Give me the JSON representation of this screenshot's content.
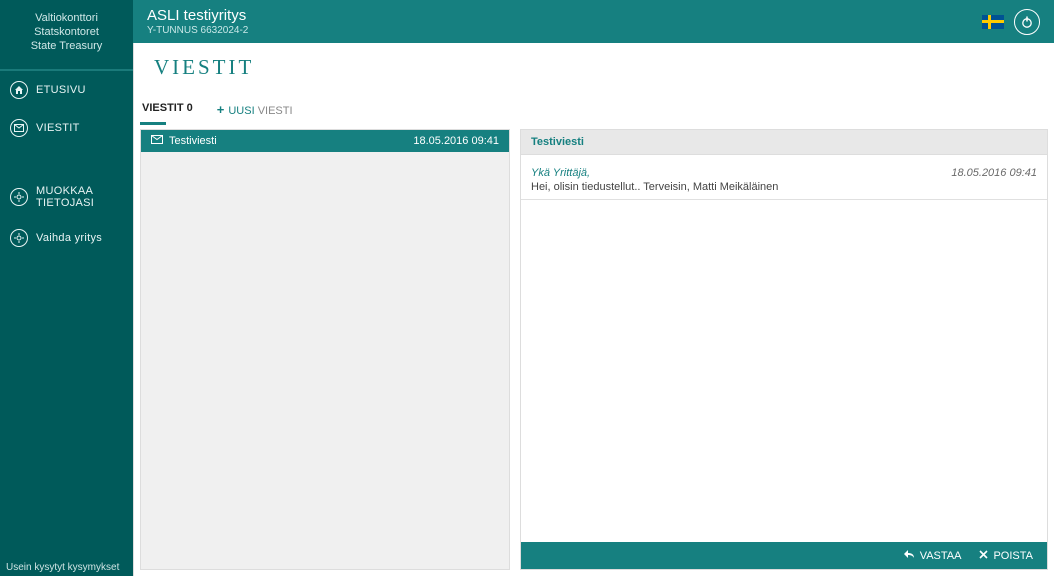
{
  "sidebar": {
    "logo_line1": "Valtiokonttori",
    "logo_line2": "Statskontoret",
    "logo_line3": "State Treasury",
    "nav": {
      "home": "ETUSIVU",
      "messages": "VIESTIT",
      "edit_info": "MUOKKAA TIETOJASI",
      "change_company": "Vaihda yritys"
    },
    "footer": "Usein kysytyt kysymykset"
  },
  "topbar": {
    "company_name": "ASLI testiyritys",
    "company_id_label": "Y-TUNNUS 6632024-2",
    "language": "sv"
  },
  "page": {
    "title": "VIESTIT",
    "tabs": {
      "list_label_prefix": "VIESTIT",
      "list_count": "0",
      "new_prefix": "UUSI",
      "new_suffix": "VIESTI"
    }
  },
  "messages": {
    "list": [
      {
        "subject": "Testiviesti",
        "datetime": "18.05.2016 09:41"
      }
    ],
    "selected": {
      "subject": "Testiviesti",
      "sender": "Ykä Yrittäjä,",
      "datetime": "18.05.2016 09:41",
      "body": "Hei, olisin tiedustellut.. Terveisin, Matti Meikäläinen"
    }
  },
  "actions": {
    "reply": "VASTAA",
    "delete": "POISTA"
  }
}
